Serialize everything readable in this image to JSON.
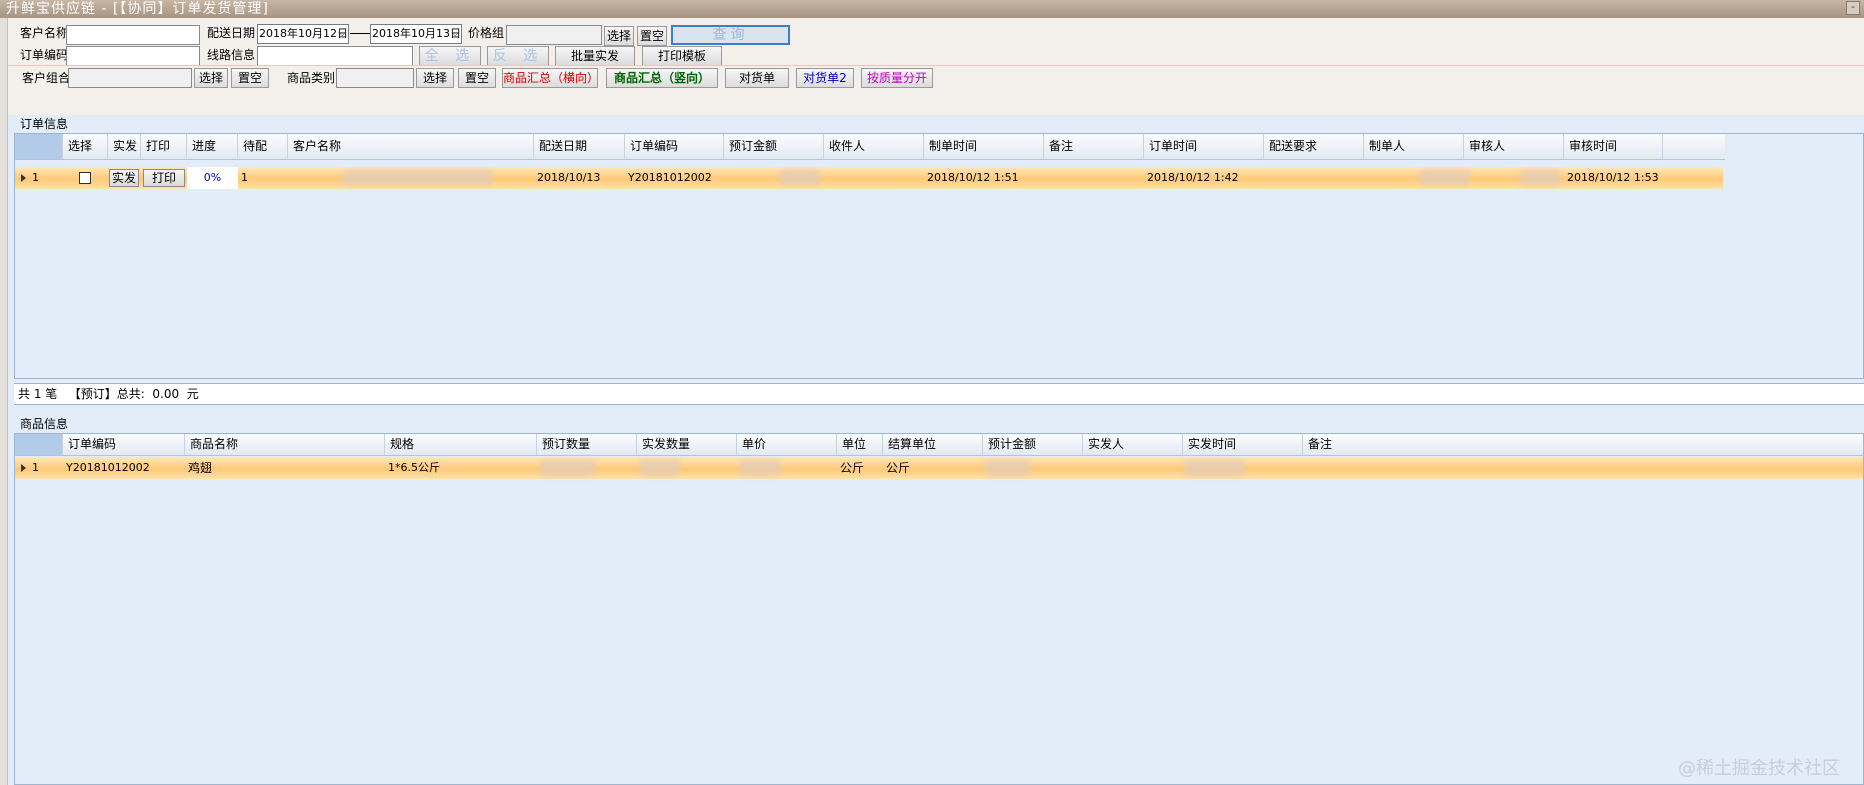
{
  "window": {
    "title": "升鲜宝供应链 - [【协同】订单发货管理]",
    "minimize_glyph": "-"
  },
  "filters": {
    "customer_name_label": "客户名称",
    "order_code_label": "订单编码",
    "customer_group_label": "客户组合:",
    "delivery_date_label": "配送日期",
    "date_from": "2018年10月12日",
    "date_to": "2018年10月13日",
    "route_label": "线路信息",
    "price_group_label": "价格组",
    "product_category_label": "商品类别"
  },
  "buttons": {
    "select": "选择",
    "clear": "置空",
    "query": "查询",
    "select_all": "全 选",
    "invert": "反 选",
    "batch_ship": "批量实发",
    "print_template": "打印模板",
    "product_summary_h": "商品汇总（横向）",
    "product_summary_v": "商品汇总（竖向）",
    "reconcile": "对货单",
    "reconcile2": "对货单2",
    "split_by_quality": "按质量分开"
  },
  "colors": {
    "summary_h": "#d40000",
    "summary_v": "#006400",
    "reconcile2": "#0000c0",
    "split_by_quality": "#c000c0",
    "progress": "#0000cc"
  },
  "order_panel": {
    "title": "订单信息",
    "columns": [
      "选择",
      "实发",
      "打印",
      "进度",
      "待配",
      "客户名称",
      "配送日期",
      "订单编码",
      "预订金额",
      "收件人",
      "制单时间",
      "备注",
      "订单时间",
      "配送要求",
      "制单人",
      "审核人",
      "审核时间"
    ],
    "rows": [
      {
        "index": "1",
        "selected": false,
        "ship_btn": "实发",
        "print_btn": "打印",
        "progress": "0%",
        "pending": "1",
        "delivery_date": "2018/10/13",
        "order_code": "Y20181012002",
        "created_time": "2018/10/12 1:51",
        "order_time": "2018/10/12 1:42",
        "review_time": "2018/10/12 1:53"
      }
    ],
    "summary": "共 1 笔   【预订】总共:  0.00  元"
  },
  "product_panel": {
    "title": "商品信息",
    "columns": [
      "订单编码",
      "商品名称",
      "规格",
      "预订数量",
      "实发数量",
      "单价",
      "单位",
      "结算单位",
      "预计金额",
      "实发人",
      "实发时间",
      "备注"
    ],
    "rows": [
      {
        "index": "1",
        "order_code": "Y20181012002",
        "product_name": "鸡翅",
        "spec": "1*6.5公斤",
        "unit": "公斤",
        "settle_unit": "公斤"
      }
    ]
  },
  "watermark": "@稀土掘金技术社区"
}
